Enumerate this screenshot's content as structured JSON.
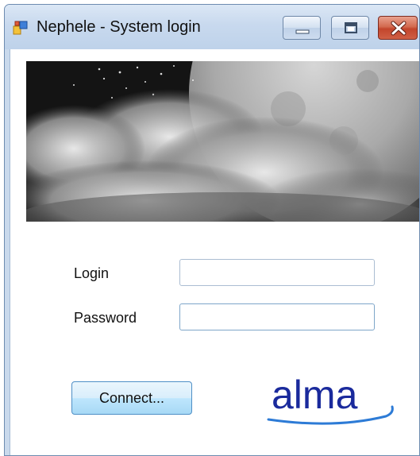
{
  "window": {
    "title": "Nephele - System login",
    "controls": {
      "minimize": "minimize",
      "maximize": "maximize",
      "close": "close"
    }
  },
  "form": {
    "login_label": "Login",
    "login_value": "",
    "password_label": "Password",
    "password_value": "",
    "connect_label": "Connect..."
  },
  "logo": {
    "text": "alma",
    "color": "#1a2a9c"
  },
  "icons": [
    "app-icon",
    "minimize-icon",
    "maximize-icon",
    "close-icon"
  ],
  "colors": {
    "titlebar": "#c8d9ee",
    "close_button": "#c3452c",
    "button_border": "#4f8fc6"
  }
}
